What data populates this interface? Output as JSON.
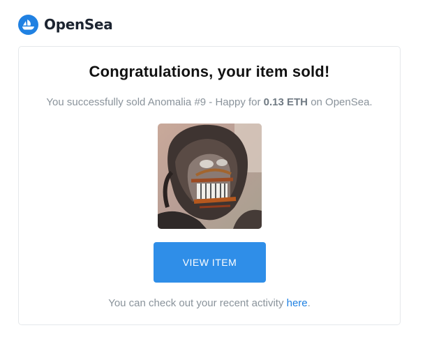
{
  "brand": {
    "name": "OpenSea",
    "logo_icon": "opensea-boat-logo-icon",
    "logo_color": "#2081e2"
  },
  "email": {
    "title": "Congratulations, your item sold!",
    "sold_prefix": "You successfully sold Anomalia #9 - Happy for ",
    "price": "0.13 ETH",
    "sold_suffix": " on OpenSea.",
    "item_image_alt": "Anomalia #9 - Happy",
    "view_button_label": "VIEW ITEM",
    "view_button_color": "#2f8ee8",
    "activity_prefix": "You can check out your recent activity ",
    "activity_link": "here",
    "activity_suffix": "."
  }
}
